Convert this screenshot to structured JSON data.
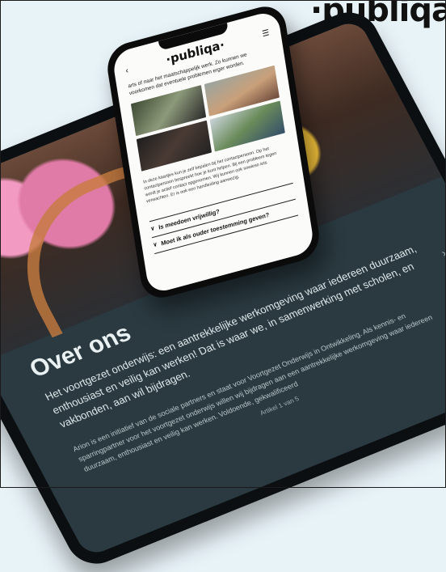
{
  "brand": {
    "logo_text": "·publiqa·"
  },
  "phone": {
    "logo_text": "·publiqa·",
    "back_icon": "chevron-left-icon",
    "menu_icon": "hamburger-menu-icon",
    "intro_text": "arts of naar het maatschappelijk werk. Zo kunnen we voorkomen dat eventuele problemen erger worden.",
    "body_text": "In deze kaartjes kun je zelf bepalen bij het contactpersoon. Op het contactpersoon bespreekt hoe je kunt helpen. Bij een probleem tegen wordt je actief contact opgenomen. Wij kunnen ook sowieso iets verwachten. Er is ook een handleiding aanwezig.",
    "accordion": [
      {
        "label": "Is meedoen vrijwillig?"
      },
      {
        "label": "Moet ik als ouder toestemming geven?"
      }
    ]
  },
  "tablet": {
    "heading": "Over ons",
    "intro": "Het voortgezet onderwijs: een aantrekkelijke werkomgeving waar iedereen duurzaam, enthousiast en veilig kan werken! Dat is waar we, in samenwerking met scholen, en vakbonden, aan wil bijdragen.",
    "body": "Arion is een initiatief van de sociale partners en staat voor Voortgezet Onderwijs in Ontwikkeling. Als kennis- en sparringpartner voor het voortgezet onderwijs willen wij bijdragen aan een aantrekkelijke werkomgeving waar iedereen duurzaam, enthousiast en veilig kan werken. Voldoende, gekwalificeerd",
    "pagination": "Artikel 1 van 5",
    "next_icon": "chevron-right-icon"
  },
  "colors": {
    "background": "#e8f3f8",
    "tablet_screen": "#2a3a40",
    "device_frame": "#0b0f12"
  }
}
